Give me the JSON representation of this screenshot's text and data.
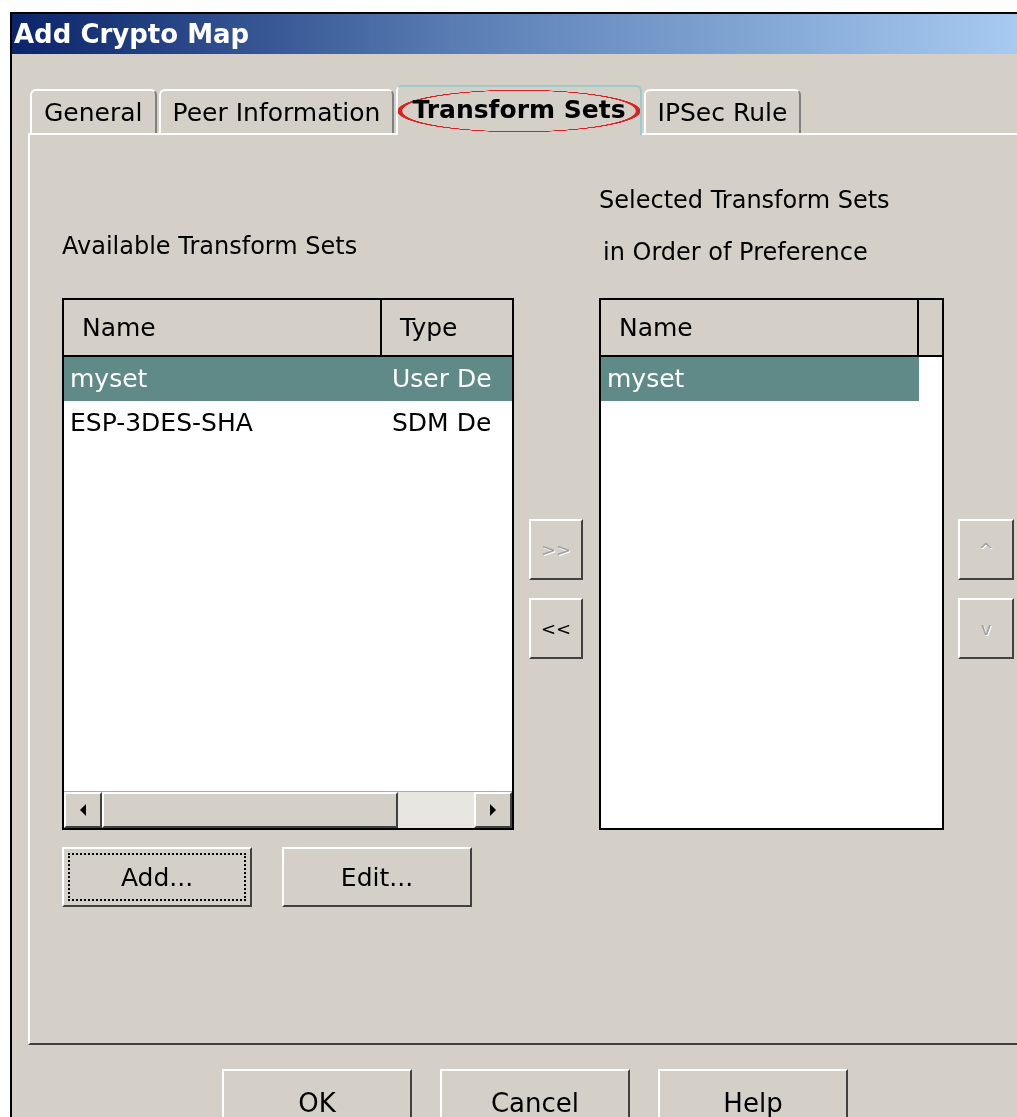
{
  "window": {
    "title": "Add Crypto Map"
  },
  "tabs": [
    {
      "label": "General",
      "selected": false,
      "circled": false
    },
    {
      "label": "Peer Information",
      "selected": false,
      "circled": false
    },
    {
      "label": "Transform Sets",
      "selected": true,
      "circled": true
    },
    {
      "label": "IPSec Rule",
      "selected": false,
      "circled": false
    }
  ],
  "available": {
    "label": "Available Transform Sets",
    "columns": [
      "Name",
      "Type"
    ],
    "rows": [
      {
        "cells": [
          "myset",
          "User De"
        ],
        "selected": true
      },
      {
        "cells": [
          "ESP-3DES-SHA",
          "SDM De"
        ],
        "selected": false
      }
    ]
  },
  "move_buttons": [
    {
      "label": ">>",
      "disabled": true
    },
    {
      "label": "<<",
      "disabled": false
    }
  ],
  "chosen": {
    "label_lines": [
      "Selected Transform Sets",
      "in Order of Preference"
    ],
    "columns": [
      "Name"
    ],
    "rows": [
      {
        "cells": [
          "myset"
        ],
        "selected": true
      }
    ]
  },
  "order_buttons": [
    {
      "label": "^",
      "disabled": true
    },
    {
      "label": "v",
      "disabled": true
    }
  ],
  "list_buttons": [
    {
      "label": "Add...",
      "focused": true
    },
    {
      "label": "Edit...",
      "focused": false
    }
  ],
  "dialog_buttons": [
    "OK",
    "Cancel",
    "Help"
  ]
}
